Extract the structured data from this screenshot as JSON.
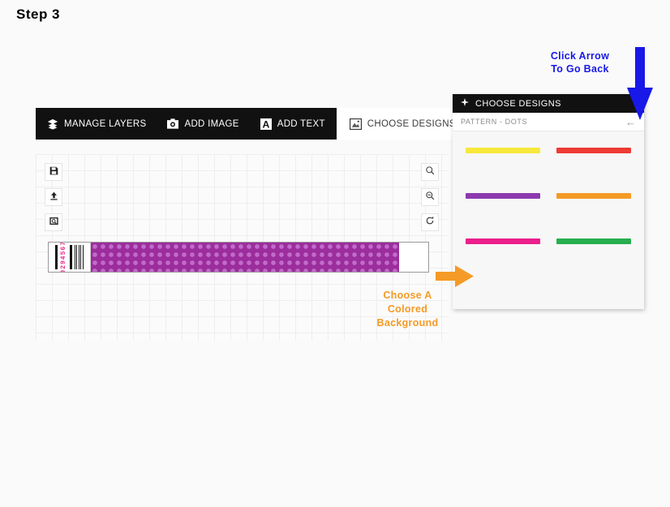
{
  "page": {
    "step_title": "Step 3"
  },
  "toolbar": {
    "items": [
      {
        "label": "MANAGE LAYERS",
        "icon": "layers-icon"
      },
      {
        "label": "ADD IMAGE",
        "icon": "camera-icon"
      },
      {
        "label": "ADD TEXT",
        "icon": "text-a-icon"
      },
      {
        "label": "CHOOSE DESIGNS",
        "icon": "image-icon"
      }
    ]
  },
  "canvas": {
    "left_tools": [
      {
        "name": "save-button",
        "icon": "floppy-disk-icon"
      },
      {
        "name": "upload-button",
        "icon": "upload-arrow-icon"
      },
      {
        "name": "preview-button",
        "icon": "preview-search-icon"
      }
    ],
    "right_tools": [
      {
        "name": "zoom-in-button",
        "icon": "magnifier-plus-icon"
      },
      {
        "name": "zoom-out-button",
        "icon": "magnifier-minus-icon"
      },
      {
        "name": "reset-button",
        "icon": "refresh-icon"
      }
    ],
    "wristband": {
      "serial": "0294567",
      "pattern_name": "dots",
      "pattern_color": "#9c2d9c",
      "pattern_dot_color": "#c06cc9"
    }
  },
  "panel": {
    "title": "CHOOSE DESIGNS",
    "title_icon": "move-cross-icon",
    "breadcrumb": "PATTERN - DOTS",
    "back_icon": "back-arrow-icon",
    "swatches": [
      {
        "name": "yellow",
        "color": "#f7e83a"
      },
      {
        "name": "red",
        "color": "#ee3b33"
      },
      {
        "name": "purple",
        "color": "#8b3aae"
      },
      {
        "name": "orange",
        "color": "#f59a26"
      },
      {
        "name": "pink",
        "color": "#ec1e8c"
      },
      {
        "name": "green",
        "color": "#27ae4f"
      }
    ]
  },
  "annotations": {
    "blue": {
      "line1": "Click Arrow",
      "line2": "To Go Back",
      "color": "#1818e8"
    },
    "orange": {
      "line1": "Choose A",
      "line2": "Colored",
      "line3": "Background",
      "color": "#f59a26"
    }
  }
}
